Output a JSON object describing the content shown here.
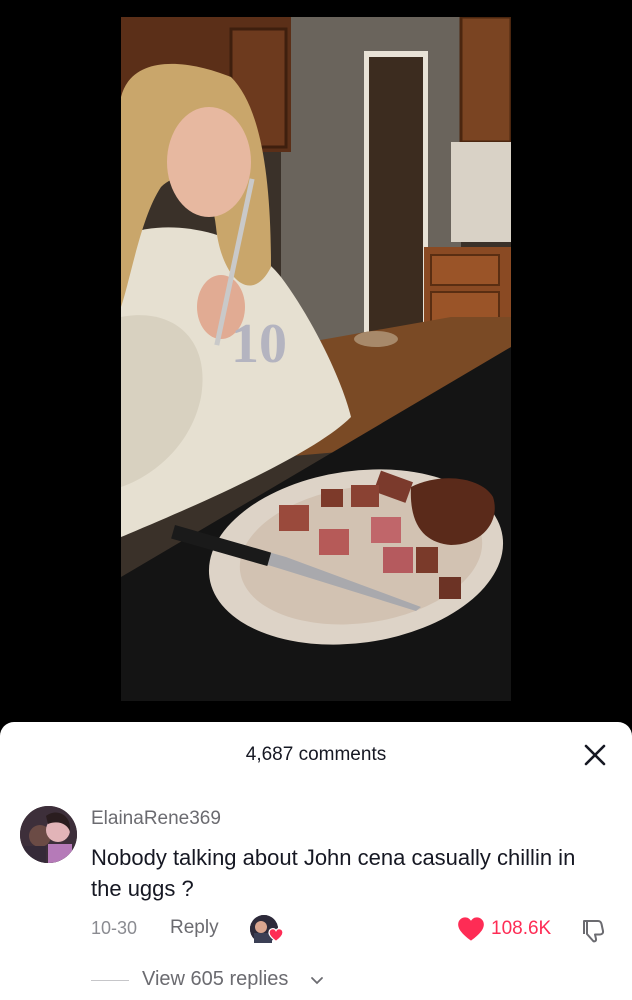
{
  "comments_sheet": {
    "count_label": "4,687 comments",
    "close_icon": "close-icon"
  },
  "comment": {
    "username": "ElainaRene369",
    "text": "Nobody talking about John cena casually chillin in the uggs ?",
    "date": "10-30",
    "reply_label": "Reply",
    "like_count": "108.6K",
    "liked": true,
    "liked_by_creator": true,
    "view_replies_label": "View 605 replies"
  },
  "colors": {
    "like_red": "#fe2c55",
    "text_primary": "#161823",
    "text_secondary": "#6b6b70"
  }
}
